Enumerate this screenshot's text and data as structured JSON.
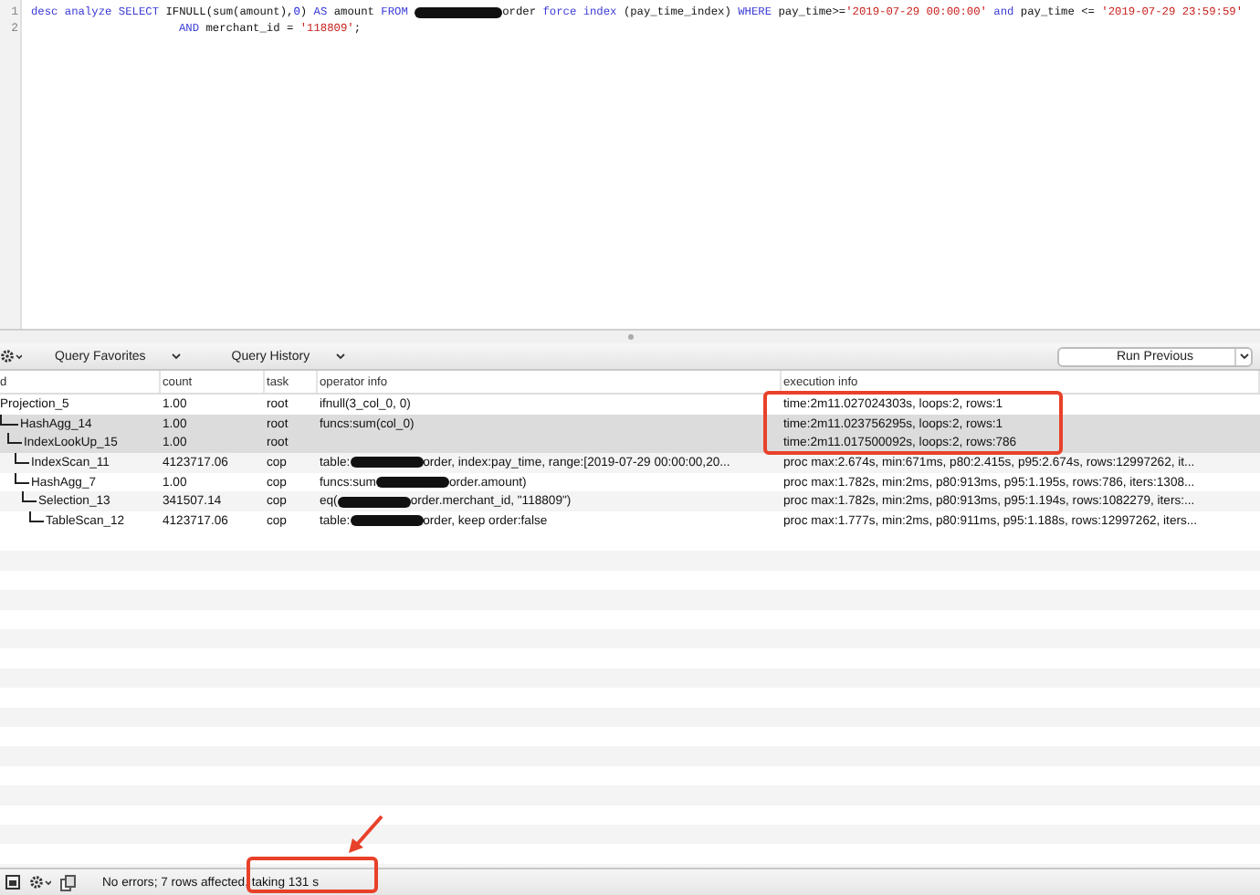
{
  "editor": {
    "lines": [
      {
        "number": "1",
        "tokens": [
          {
            "kind": "keyword",
            "text": "desc analyze SELECT "
          },
          {
            "kind": "plain",
            "text": "IFNULL(sum(amount),"
          },
          {
            "kind": "number",
            "text": "0"
          },
          {
            "kind": "plain",
            "text": ") "
          },
          {
            "kind": "keyword",
            "text": "AS "
          },
          {
            "kind": "plain",
            "text": "amount "
          },
          {
            "kind": "keyword",
            "text": "FROM "
          },
          {
            "kind": "redaction"
          },
          {
            "kind": "plain",
            "text": "order "
          },
          {
            "kind": "keyword",
            "text": "force index "
          },
          {
            "kind": "plain",
            "text": "(pay_time_index) "
          },
          {
            "kind": "keyword",
            "text": "WHERE "
          },
          {
            "kind": "plain",
            "text": "pay_time>="
          },
          {
            "kind": "string",
            "text": "'2019-07-29 00:00:00'"
          },
          {
            "kind": "keyword",
            "text": " and "
          },
          {
            "kind": "plain",
            "text": "pay_time <= "
          },
          {
            "kind": "string",
            "text": "'2019-07-29 23:59:59'"
          }
        ]
      },
      {
        "number": "2",
        "indent": true,
        "tokens": [
          {
            "kind": "keyword",
            "text": "AND "
          },
          {
            "kind": "plain",
            "text": "merchant_id = "
          },
          {
            "kind": "string",
            "text": "'118809'"
          },
          {
            "kind": "plain",
            "text": ";"
          }
        ]
      }
    ]
  },
  "toolbar": {
    "favorites": "Query Favorites",
    "history": "Query History",
    "run_button": "Run Previous"
  },
  "table": {
    "columns": [
      "d",
      "count",
      "task",
      "operator info",
      "execution info"
    ],
    "rows": [
      {
        "id": "Projection_5",
        "count": "1.00",
        "task": "root",
        "selected": false,
        "operator": [
          {
            "kind": "text",
            "text": "ifnull(3_col_0, 0)"
          }
        ],
        "execution": "time:2m11.027024303s, loops:2, rows:1",
        "children": [
          {
            "id": "HashAgg_14",
            "count": "1.00",
            "task": "root",
            "selected": true,
            "operator": [
              {
                "kind": "text",
                "text": "funcs:sum(col_0)"
              }
            ],
            "execution": "time:2m11.023756295s, loops:2, rows:1",
            "children": [
              {
                "id": "IndexLookUp_15",
                "count": "1.00",
                "task": "root",
                "selected": true,
                "execution": "time:2m11.017500092s, loops:2, rows:786",
                "children": [
                  {
                    "id": "IndexScan_11",
                    "count": "4123717.06",
                    "task": "cop",
                    "selected": false,
                    "operator": [
                      {
                        "kind": "text",
                        "text": "table:"
                      },
                      {
                        "kind": "redaction"
                      },
                      {
                        "kind": "text",
                        "text": "order, index:pay_time, range:[2019-07-29 00:00:00,20..."
                      }
                    ],
                    "execution": "proc max:2.674s, min:671ms, p80:2.415s, p95:2.674s, rows:12997262, it..."
                  },
                  {
                    "id": "HashAgg_7",
                    "count": "1.00",
                    "task": "cop",
                    "selected": false,
                    "operator": [
                      {
                        "kind": "text",
                        "text": "funcs:sum"
                      },
                      {
                        "kind": "redaction"
                      },
                      {
                        "kind": "text",
                        "text": "order.amount)"
                      }
                    ],
                    "execution": "proc max:1.782s, min:2ms, p80:913ms, p95:1.195s, rows:786, iters:1308...",
                    "children": [
                      {
                        "id": "Selection_13",
                        "count": "341507.14",
                        "task": "cop",
                        "selected": false,
                        "operator": [
                          {
                            "kind": "text",
                            "text": "eq("
                          },
                          {
                            "kind": "redaction"
                          },
                          {
                            "kind": "text",
                            "text": "order.merchant_id, \"118809\")"
                          }
                        ],
                        "execution": "proc max:1.782s, min:2ms, p80:913ms, p95:1.194s, rows:1082279, iters:...",
                        "children": [
                          {
                            "id": "TableScan_12",
                            "count": "4123717.06",
                            "task": "cop",
                            "selected": false,
                            "operator": [
                              {
                                "kind": "text",
                                "text": "table:"
                              },
                              {
                                "kind": "redaction"
                              },
                              {
                                "kind": "text",
                                "text": "order, keep order:false"
                              }
                            ],
                            "execution": "proc max:1.777s, min:2ms, p80:911ms, p95:1.188s, rows:12997262, iters..."
                          }
                        ]
                      }
                    ]
                  }
                ]
              }
            ]
          }
        ]
      }
    ]
  },
  "status_bar": {
    "message": "No errors; 7 rows affected, taking 131 s"
  }
}
